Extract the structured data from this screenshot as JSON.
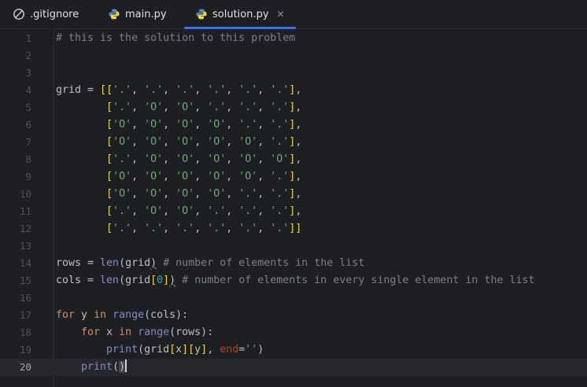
{
  "tabs": [
    {
      "label": ".gitignore",
      "icon": "gitignore-icon"
    },
    {
      "label": "main.py",
      "icon": "python-icon"
    },
    {
      "label": "solution.py",
      "icon": "python-icon",
      "active": true
    }
  ],
  "close_glyph": "✕",
  "colors": {
    "accent": "#3574f0",
    "background": "#1e1f22"
  },
  "editor": {
    "current_line": 20,
    "line_numbers": [
      "1",
      "2",
      "3",
      "4",
      "5",
      "6",
      "7",
      "8",
      "9",
      "10",
      "11",
      "12",
      "13",
      "14",
      "15",
      "16",
      "17",
      "18",
      "19",
      "20"
    ],
    "lines": [
      "# this is the solution to this problem",
      "",
      "",
      "grid = [['.', '.', '.', '.', '.', '.'],",
      "        ['.', 'O', 'O', '.', '.', '.'],",
      "        ['O', 'O', 'O', 'O', '.', '.'],",
      "        ['O', 'O', 'O', 'O', 'O', '.'],",
      "        ['.', 'O', 'O', 'O', 'O', 'O'],",
      "        ['O', 'O', 'O', 'O', 'O', '.'],",
      "        ['O', 'O', 'O', 'O', '.', '.'],",
      "        ['.', 'O', 'O', '.', '.', '.'],",
      "        ['.', '.', '.', '.', '.', '.']]",
      "",
      "rows = len(grid) # number of elements in the list",
      "cols = len(grid[0]) # number of elements in every single element in the list",
      "",
      "for y in range(cols):",
      "    for x in range(rows):",
      "        print(grid[x][y], end='')",
      "    print()"
    ]
  }
}
